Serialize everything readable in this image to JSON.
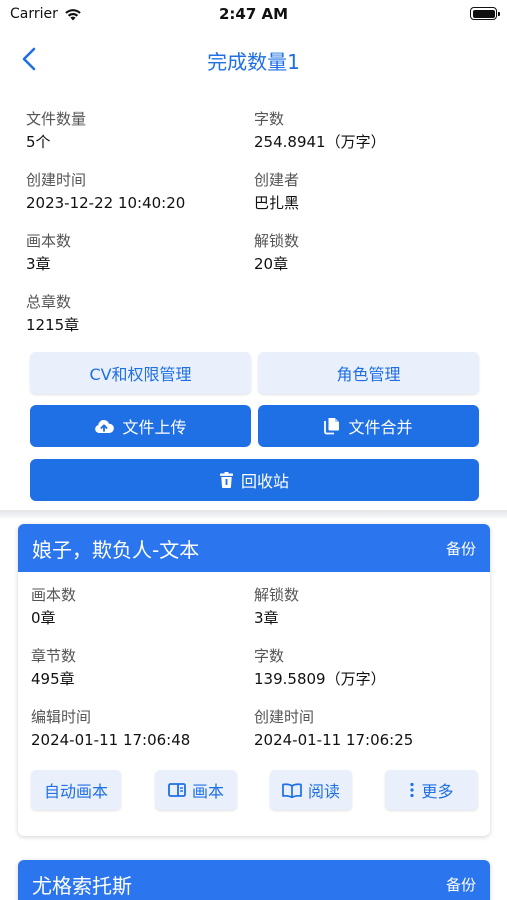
{
  "status": {
    "carrier": "Carrier",
    "time": "2:47 AM"
  },
  "nav": {
    "title": "完成数量1"
  },
  "info": [
    {
      "label": "文件数量",
      "value": "5个"
    },
    {
      "label": "字数",
      "value": "254.8941（万字）"
    },
    {
      "label": "创建时间",
      "value": "2023-12-22 10:40:20"
    },
    {
      "label": "创建者",
      "value": "巴扎黑"
    },
    {
      "label": "画本数",
      "value": "3章"
    },
    {
      "label": "解锁数",
      "value": "20章"
    },
    {
      "label": "总章数",
      "value": "1215章"
    }
  ],
  "actions": {
    "cv_permissions": "CV和权限管理",
    "role_management": "角色管理",
    "file_upload": "文件上传",
    "file_merge": "文件合并",
    "recycle_bin": "回收站"
  },
  "cards": [
    {
      "title": "娘子，欺负人-文本",
      "backup": "备份",
      "fields": [
        {
          "label": "画本数",
          "value": "0章"
        },
        {
          "label": "解锁数",
          "value": "3章"
        },
        {
          "label": "章节数",
          "value": "495章"
        },
        {
          "label": "字数",
          "value": "139.5809（万字）"
        },
        {
          "label": "编辑时间",
          "value": "2024-01-11 17:06:48"
        },
        {
          "label": "创建时间",
          "value": "2024-01-11 17:06:25"
        }
      ],
      "buttons": {
        "auto_draw": "自动画本",
        "draw": "画本",
        "read": "阅读",
        "more": "更多"
      }
    },
    {
      "title": "尤格索托斯",
      "backup": "备份"
    }
  ],
  "colors": {
    "primary": "#1f6fe5",
    "header": "#2b76ee",
    "light": "#e9f0fb"
  }
}
